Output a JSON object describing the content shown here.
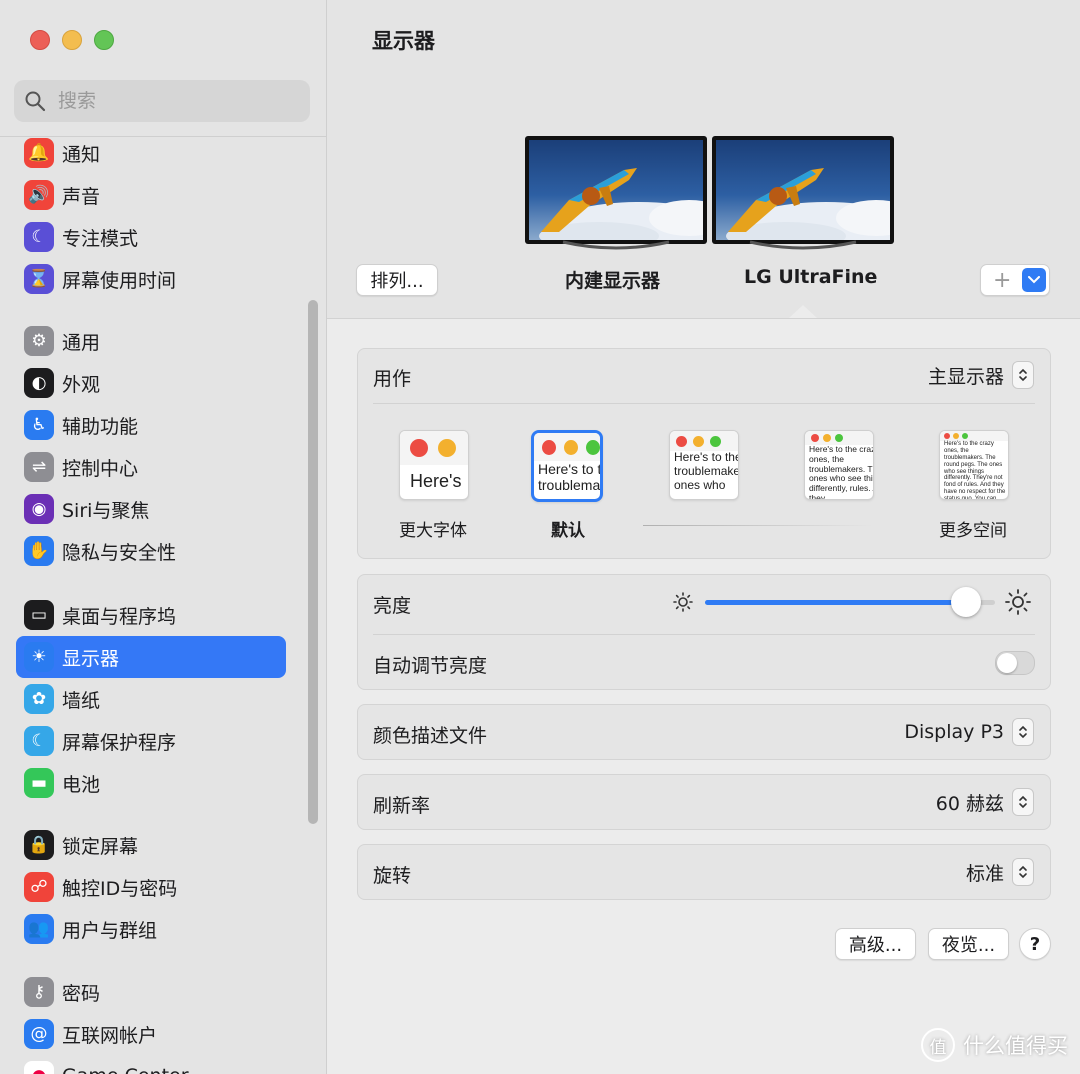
{
  "window": {
    "title": "显示器"
  },
  "search": {
    "placeholder": "搜索"
  },
  "sidebar": {
    "items": [
      {
        "label": "通知",
        "icon": "bell-icon",
        "color": "#f0443a"
      },
      {
        "label": "声音",
        "icon": "speaker-icon",
        "color": "#f0443a"
      },
      {
        "label": "专注模式",
        "icon": "moon-icon",
        "color": "#5a4fd6"
      },
      {
        "label": "屏幕使用时间",
        "icon": "hourglass-icon",
        "color": "#5a4fd6"
      },
      {
        "label": "通用",
        "icon": "gear-icon",
        "color": "#8e8e93"
      },
      {
        "label": "外观",
        "icon": "appearance-icon",
        "color": "#1c1c1e"
      },
      {
        "label": "辅助功能",
        "icon": "accessibility-icon",
        "color": "#2a7bf0"
      },
      {
        "label": "控制中心",
        "icon": "toggles-icon",
        "color": "#8e8e93"
      },
      {
        "label": "Siri与聚焦",
        "icon": "siri-icon",
        "color": "#6b2fb5"
      },
      {
        "label": "隐私与安全性",
        "icon": "hand-icon",
        "color": "#2a7bf0"
      },
      {
        "label": "桌面与程序坞",
        "icon": "dock-icon",
        "color": "#1c1c1e"
      },
      {
        "label": "显示器",
        "icon": "sun-icon",
        "color": "#2a7bf0",
        "active": true
      },
      {
        "label": "墙纸",
        "icon": "flower-icon",
        "color": "#35a7e8"
      },
      {
        "label": "屏幕保护程序",
        "icon": "screensaver-icon",
        "color": "#35a7e8"
      },
      {
        "label": "电池",
        "icon": "battery-icon",
        "color": "#34c759"
      },
      {
        "label": "锁定屏幕",
        "icon": "lock-icon",
        "color": "#1c1c1e"
      },
      {
        "label": "触控ID与密码",
        "icon": "fingerprint-icon",
        "color": "#f0443a"
      },
      {
        "label": "用户与群组",
        "icon": "users-icon",
        "color": "#2a7bf0"
      },
      {
        "label": "密码",
        "icon": "key-icon",
        "color": "#8e8e93"
      },
      {
        "label": "互联网帐户",
        "icon": "at-icon",
        "color": "#2a7bf0"
      },
      {
        "label": "Game Center",
        "icon": "gamecenter-icon",
        "color": "#ffffff"
      }
    ]
  },
  "header": {
    "arrange_label": "排列...",
    "displays": [
      {
        "label": "内建显示器"
      },
      {
        "label": "LG UltraFine",
        "selected": true
      }
    ],
    "add_label": "+"
  },
  "use_as": {
    "label": "用作",
    "value": "主显示器"
  },
  "scaling": {
    "options": [
      {
        "caption": "更大字体",
        "sample": "Here's"
      },
      {
        "caption": "默认",
        "sample": "Here's to the troublemakers",
        "selected": true
      },
      {
        "caption": "",
        "sample": "Here's to the troublemakers, the ones who"
      },
      {
        "caption": "",
        "sample": "Here's to the crazy ones, the troublemakers. The ones who see things differently, rules. And they"
      },
      {
        "caption": "更多空间",
        "sample": "Here's to the crazy ones, the troublemakers. The round pegs. The ones who see things differently. They're not fond of rules. And they have no respect for the status quo. You can quote them, disagree with them. About the only thing you can't do is ignore them. Because they change things."
      }
    ]
  },
  "brightness": {
    "label": "亮度",
    "value": 0.9
  },
  "auto_brightness": {
    "label": "自动调节亮度",
    "enabled": false
  },
  "color_profile": {
    "label": "颜色描述文件",
    "value": "Display P3"
  },
  "refresh_rate": {
    "label": "刷新率",
    "value": "60 赫兹"
  },
  "rotation": {
    "label": "旋转",
    "value": "标准"
  },
  "footer": {
    "advanced_label": "高级...",
    "night_shift_label": "夜览...",
    "help_label": "?"
  },
  "watermark": {
    "text": "什么值得买",
    "badge": "值"
  }
}
